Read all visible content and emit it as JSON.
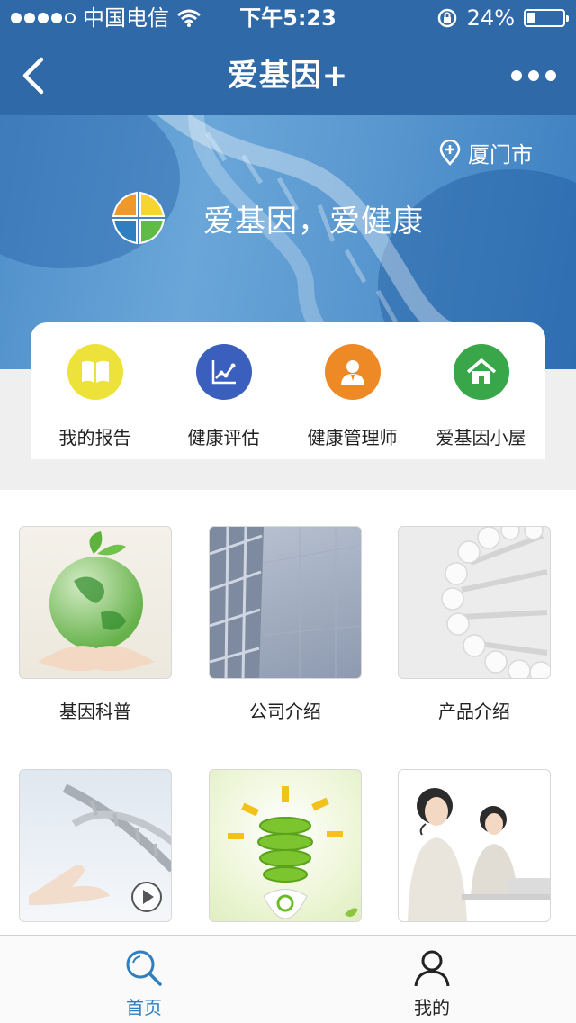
{
  "status_bar": {
    "carrier": "中国电信",
    "time": "下午5:23",
    "battery": "24%",
    "battery_level": 0.24
  },
  "nav": {
    "title": "爱基因+"
  },
  "banner": {
    "location": "厦门市",
    "slogan": "爱基因，爱健康"
  },
  "features": [
    {
      "label": "我的报告",
      "icon": "book-icon",
      "color": "#ece23a"
    },
    {
      "label": "健康评估",
      "icon": "chart-icon",
      "color": "#3a5fbd"
    },
    {
      "label": "健康管理师",
      "icon": "person-icon",
      "color": "#ee8a25"
    },
    {
      "label": "爱基因小屋",
      "icon": "home-icon",
      "color": "#3aa64a"
    }
  ],
  "tiles": [
    {
      "caption": "基因科普"
    },
    {
      "caption": "公司介绍"
    },
    {
      "caption": "产品介绍"
    },
    {
      "caption": ""
    },
    {
      "caption": ""
    },
    {
      "caption": ""
    }
  ],
  "tabbar": {
    "home": "首页",
    "mine": "我的"
  },
  "colors": {
    "primary": "#2f69a8",
    "tab_active": "#2f7fc0"
  }
}
